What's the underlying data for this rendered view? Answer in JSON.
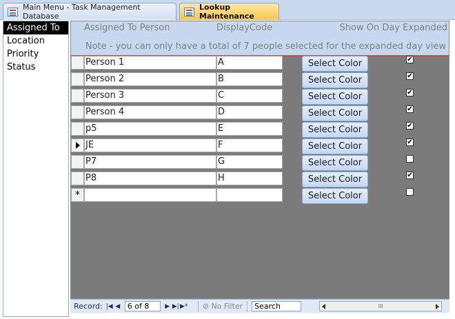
{
  "tabs": [
    {
      "label": "Main Menu - Task Management Database",
      "active": false
    },
    {
      "label": "Lookup Maintenance",
      "active": true
    }
  ],
  "left_list": {
    "items": [
      {
        "label": "Assigned To",
        "selected": true
      },
      {
        "label": "Location",
        "selected": false
      },
      {
        "label": "Priority",
        "selected": false
      },
      {
        "label": "Status",
        "selected": false
      }
    ]
  },
  "form": {
    "header": {
      "col_person": "Assigned To Person",
      "col_code": "DisplayCode",
      "col_show": "Show On Day Expanded",
      "note": "Note - you can only have a total of 7 people selected for the expanded day view"
    },
    "button_label": "Select Color",
    "rows": [
      {
        "person": "Person 1",
        "code": "A",
        "show": true
      },
      {
        "person": "Person 2",
        "code": "B",
        "show": true
      },
      {
        "person": "Person 3",
        "code": "C",
        "show": true
      },
      {
        "person": "Person 4",
        "code": "D",
        "show": true
      },
      {
        "person": "p5",
        "code": "E",
        "show": true
      },
      {
        "person": "JE",
        "code": "F",
        "show": true,
        "current": true
      },
      {
        "person": "P7",
        "code": "G",
        "show": false
      },
      {
        "person": "P8",
        "code": "H",
        "show": true
      }
    ],
    "new_record_marker": "*"
  },
  "navbar": {
    "record_label": "Record:",
    "record_position": "6 of 8",
    "filter_label": "No Filter",
    "search_label": "Search",
    "scroll_thumb": "III"
  },
  "colors": {
    "tab_active": "#f7c64e",
    "form_background": "#7b7b7b",
    "header_background": "#c6d9f0",
    "header_rule": "#c0504d",
    "button_background": "#c5d8f1"
  }
}
